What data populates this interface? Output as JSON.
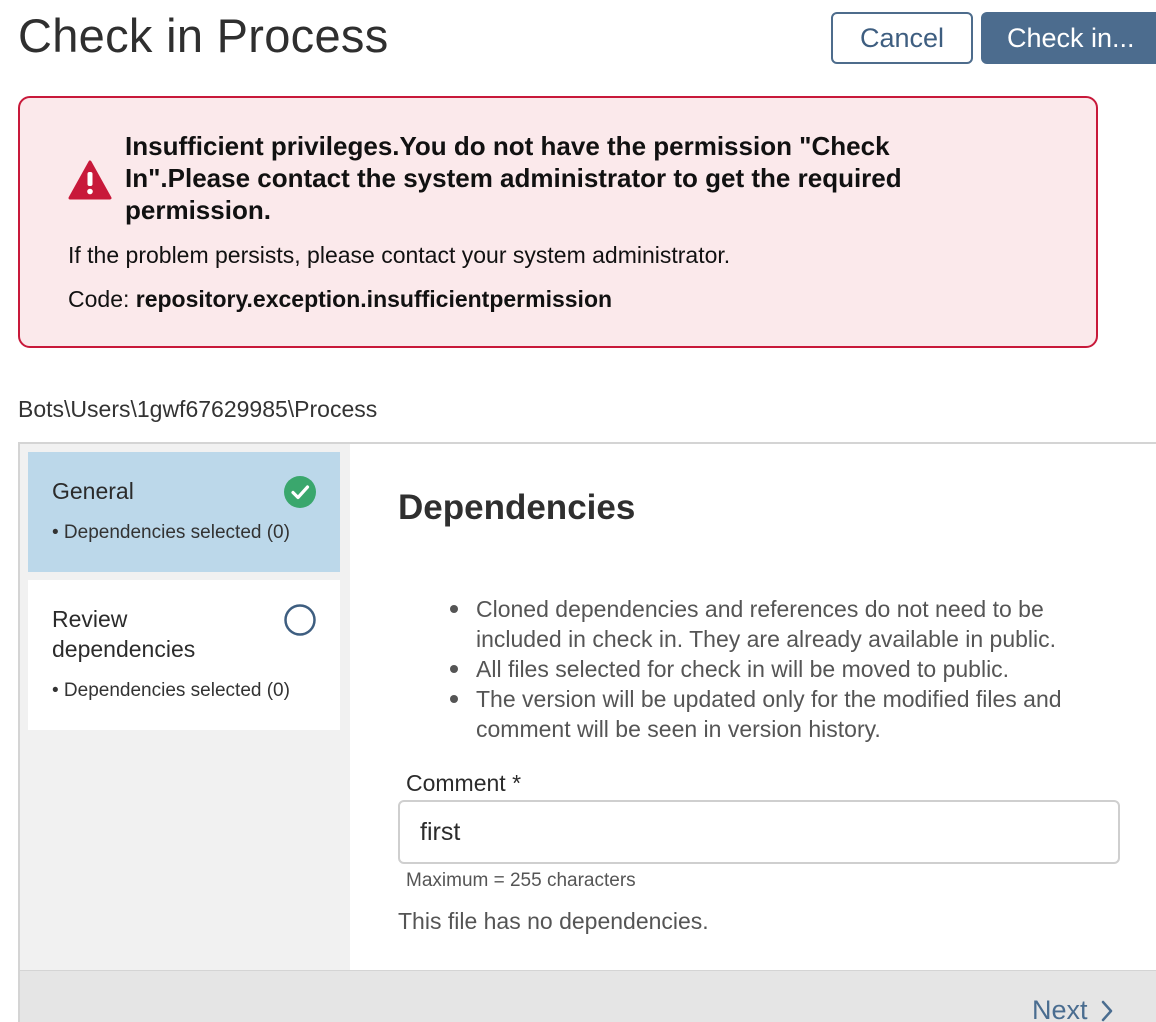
{
  "header": {
    "title": "Check in Process",
    "cancel_label": "Cancel",
    "checkin_label": "Check in..."
  },
  "error": {
    "title": "Insufficient privileges.You do not have the permission \"Check In\".Please contact the system administrator to get the required permission.",
    "persist_text": "If the problem persists, please contact your system administrator.",
    "code_label": "Code: ",
    "code_value": "repository.exception.insufficientpermission",
    "icon": "warning-triangle-icon",
    "accent_color": "#c8193a"
  },
  "breadcrumb": "Bots\\Users\\1gwf67629985\\Process",
  "steps": [
    {
      "title": "General",
      "meta": "• Dependencies selected (0)",
      "status": "complete",
      "icon": "check-circle-icon"
    },
    {
      "title": "Review dependencies",
      "meta": "• Dependencies selected (0)",
      "status": "pending",
      "icon": "empty-circle-icon"
    }
  ],
  "content": {
    "heading": "Dependencies",
    "info": [
      "Cloned dependencies and references do not need to be included in check in. They are already available in public.",
      "All files selected for check in will be moved to public.",
      "The version will be updated only for the modified files and comment will be seen in version history."
    ],
    "comment_label": "Comment *",
    "comment_value": "first",
    "comment_hint": "Maximum = 255 characters",
    "no_dependencies": "This file has no dependencies."
  },
  "footer": {
    "next_label": "Next"
  },
  "colors": {
    "primary": "#4c6c8e",
    "active_step": "#bcd8ea",
    "success": "#3aa76d"
  }
}
